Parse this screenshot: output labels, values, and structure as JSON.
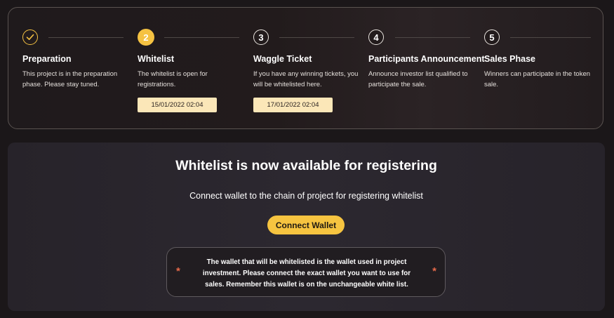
{
  "steps": [
    {
      "title": "Preparation",
      "description": "This project is in the preparation phase. Please stay tuned.",
      "marker": "",
      "status": "completed",
      "icon": "check-icon"
    },
    {
      "title": "Whitelist",
      "description": "The whitelist is open for registrations.",
      "marker": "2",
      "status": "active",
      "date": "15/01/2022 02:04"
    },
    {
      "title": "Waggle Ticket",
      "description": "If you have any winning tickets, you will be whitelisted here.",
      "marker": "3",
      "status": "upcoming",
      "date": "17/01/2022 02:04"
    },
    {
      "title": "Participants Announcement",
      "description": "Announce investor list qualified to participate the sale.",
      "marker": "4",
      "status": "upcoming"
    },
    {
      "title": "Sales Phase",
      "description": "Winners can participate in the token sale.",
      "marker": "5",
      "status": "upcoming"
    }
  ],
  "main": {
    "title": "Whitelist is now available for registering",
    "subtitle": "Connect wallet to the chain of project for registering whitelist",
    "connect_button": "Connect Wallet",
    "notice": "The wallet that will be whitelisted is the wallet used in project investment. Please connect the exact wallet you want to use for sales. Remember this wallet is on the unchangeable white list.",
    "asterisk": "*"
  },
  "colors": {
    "accent": "#f6c440",
    "date_badge_bg": "#fbe7b8",
    "asterisk": "#e5694a"
  }
}
